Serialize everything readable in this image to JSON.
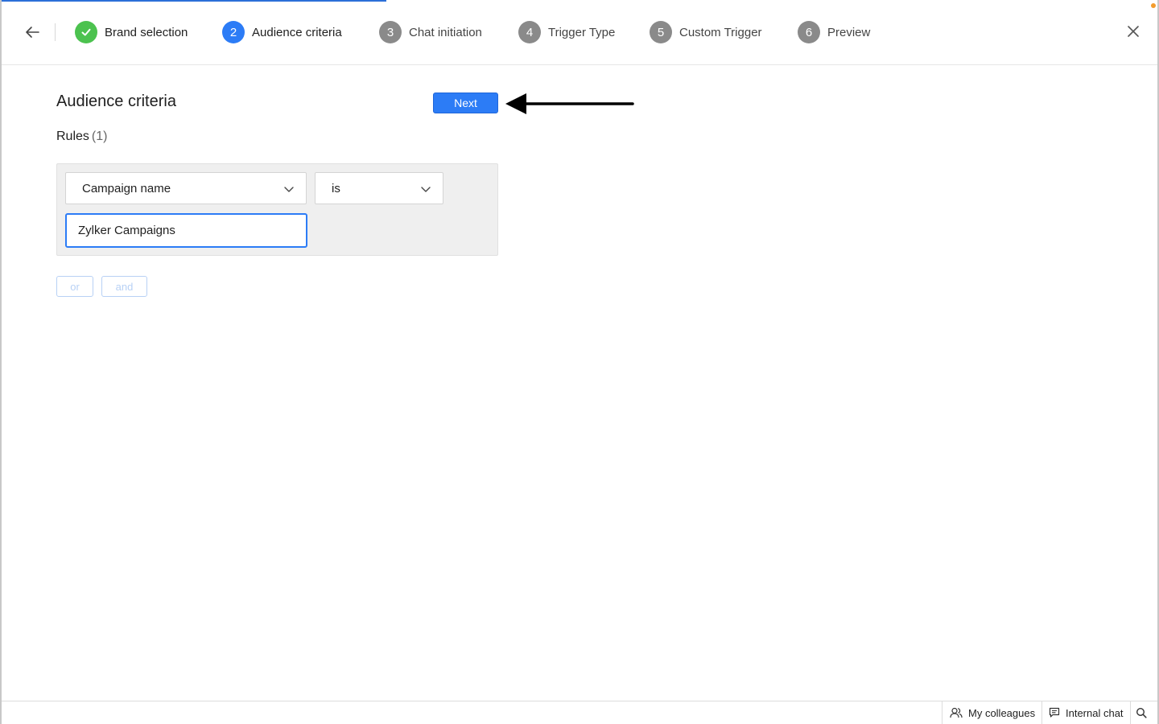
{
  "wizard": {
    "steps": [
      {
        "number": "",
        "label": "Brand selection",
        "state": "done"
      },
      {
        "number": "2",
        "label": "Audience criteria",
        "state": "active"
      },
      {
        "number": "3",
        "label": "Chat initiation",
        "state": "pending"
      },
      {
        "number": "4",
        "label": "Trigger Type",
        "state": "pending"
      },
      {
        "number": "5",
        "label": "Custom Trigger",
        "state": "pending"
      },
      {
        "number": "6",
        "label": "Preview",
        "state": "pending"
      }
    ],
    "back_icon": "arrow-left-icon",
    "close_icon": "close-icon"
  },
  "main": {
    "title": "Audience criteria",
    "next_label": "Next",
    "rules_label": "Rules",
    "rules_count": "(1)",
    "rule": {
      "field": "Campaign name",
      "operator": "is",
      "value": "Zylker Campaigns"
    },
    "or_label": "or",
    "and_label": "and"
  },
  "bottombar": {
    "colleagues_label": "My colleagues",
    "chat_label": "Internal chat"
  },
  "colors": {
    "accent": "#2c7cf6",
    "done": "#4cc24f",
    "pending": "#8a8a8a"
  }
}
